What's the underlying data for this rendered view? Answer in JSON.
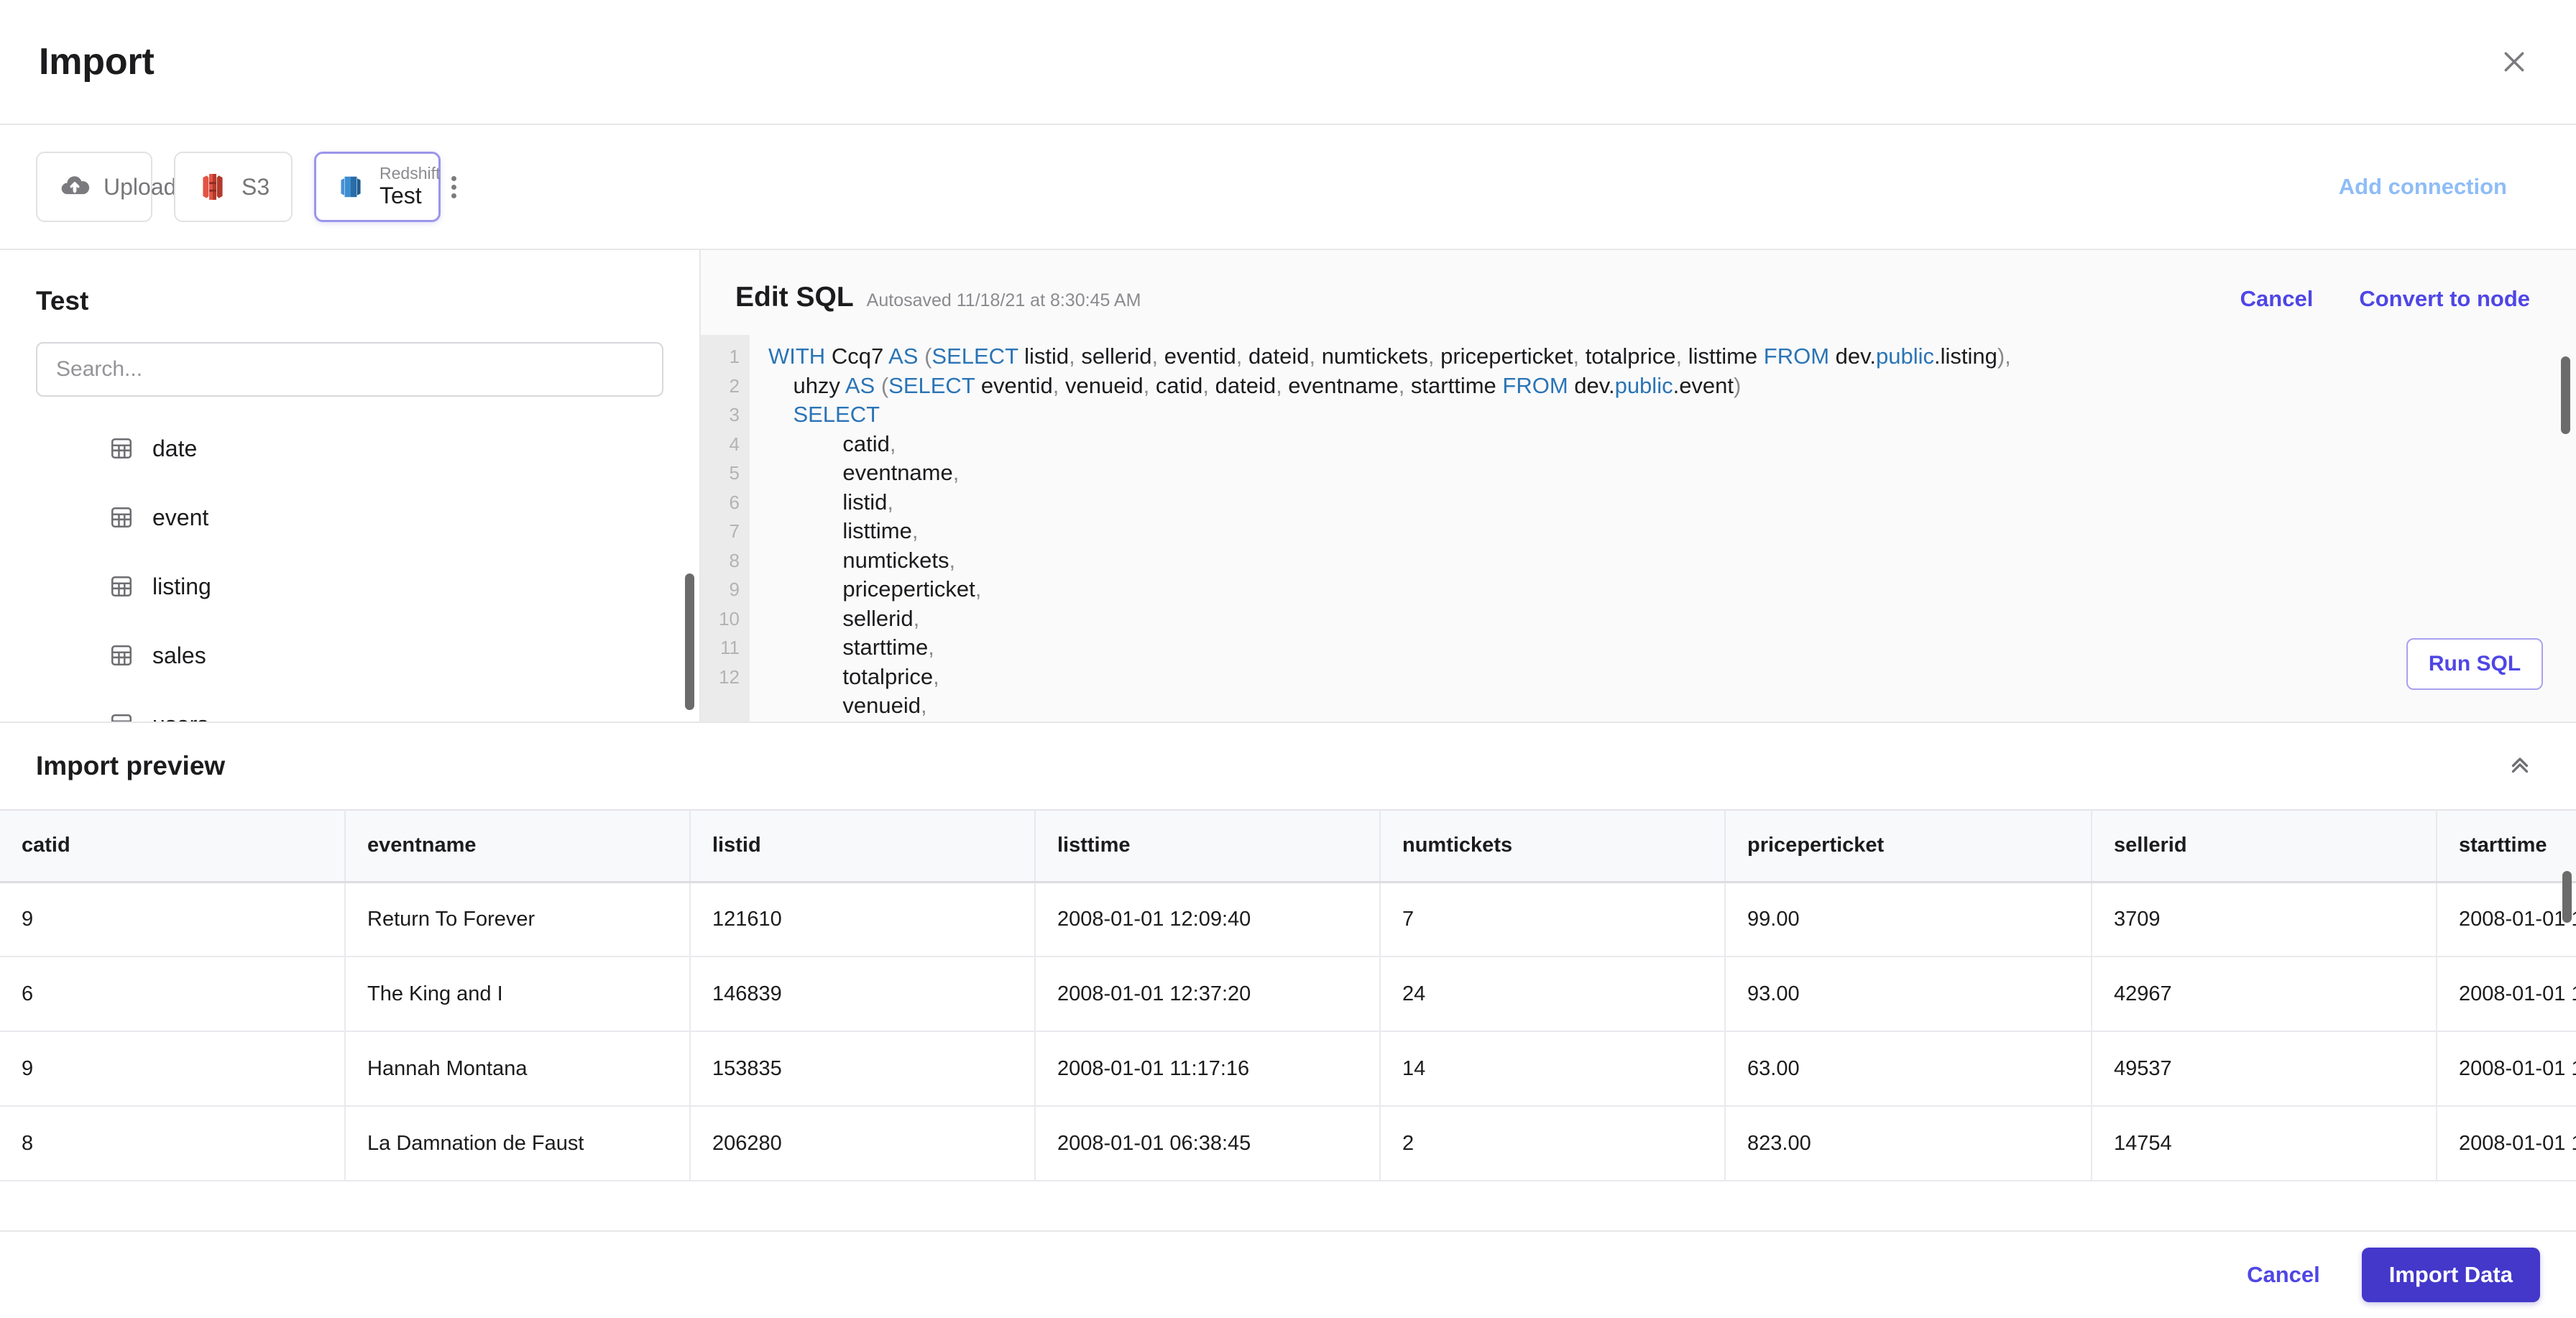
{
  "window": {
    "title": "Import",
    "close_icon": "close-icon"
  },
  "connections": {
    "add_connection_label": "Add connection",
    "items": [
      {
        "icon": "cloud-upload-icon",
        "label": "Upload",
        "kind": "",
        "name": "",
        "active": false
      },
      {
        "icon": "aws-s3-icon",
        "label": "S3",
        "kind": "",
        "name": "",
        "active": false
      },
      {
        "icon": "aws-redshift-icon",
        "label": "",
        "kind": "Redshift",
        "name": "Test",
        "active": true
      }
    ]
  },
  "sidebar": {
    "title": "Test",
    "search_placeholder": "Search...",
    "search_value": "",
    "tables": [
      {
        "icon": "table-icon",
        "label": "date"
      },
      {
        "icon": "table-icon",
        "label": "event"
      },
      {
        "icon": "table-icon",
        "label": "listing"
      },
      {
        "icon": "table-icon",
        "label": "sales"
      },
      {
        "icon": "table-icon",
        "label": "users"
      }
    ]
  },
  "sql_editor": {
    "title": "Edit SQL",
    "autosaved": "Autosaved 11/18/21 at 8:30:45 AM",
    "cancel_label": "Cancel",
    "convert_label": "Convert to node",
    "run_label": "Run SQL",
    "line_numbers": [
      "1",
      "2",
      "3",
      "4",
      "5",
      "6",
      "7",
      "8",
      "9",
      "10",
      "11",
      "12"
    ],
    "lines": [
      "WITH Ccq7 AS (SELECT listid, sellerid, eventid, dateid, numtickets, priceperticket, totalprice, listtime FROM dev.public.listing),",
      "    uhzy AS (SELECT eventid, venueid, catid, dateid, eventname, starttime FROM dev.public.event)",
      "    SELECT",
      "            catid,",
      "            eventname,",
      "            listid,",
      "            listtime,",
      "            numtickets,",
      "            priceperticket,",
      "            sellerid,",
      "            starttime,",
      "            totalprice,",
      "            venueid,"
    ]
  },
  "preview": {
    "title": "Import preview",
    "collapse_icon": "chevron-double-up-icon",
    "columns": [
      "catid",
      "eventname",
      "listid",
      "listtime",
      "numtickets",
      "priceperticket",
      "sellerid",
      "starttime"
    ],
    "rows": [
      [
        "9",
        "Return To Forever",
        "121610",
        "2008-01-01 12:09:40",
        "7",
        "99.00",
        "3709",
        "2008-01-01 1"
      ],
      [
        "6",
        "The King and I",
        "146839",
        "2008-01-01 12:37:20",
        "24",
        "93.00",
        "42967",
        "2008-01-01 1"
      ],
      [
        "9",
        "Hannah Montana",
        "153835",
        "2008-01-01 11:17:16",
        "14",
        "63.00",
        "49537",
        "2008-01-01 1"
      ],
      [
        "8",
        "La Damnation de Faust",
        "206280",
        "2008-01-01 06:38:45",
        "2",
        "823.00",
        "14754",
        "2008-01-01 1"
      ]
    ]
  },
  "footer": {
    "cancel_label": "Cancel",
    "import_label": "Import Data"
  },
  "colors": {
    "accent": "#4f46e5",
    "primary_button": "#4338ca",
    "sql_keyword": "#2a74b5",
    "add_connection": "#8ebcf7",
    "redshift": "#2e73b8",
    "s3": "#e25444"
  }
}
